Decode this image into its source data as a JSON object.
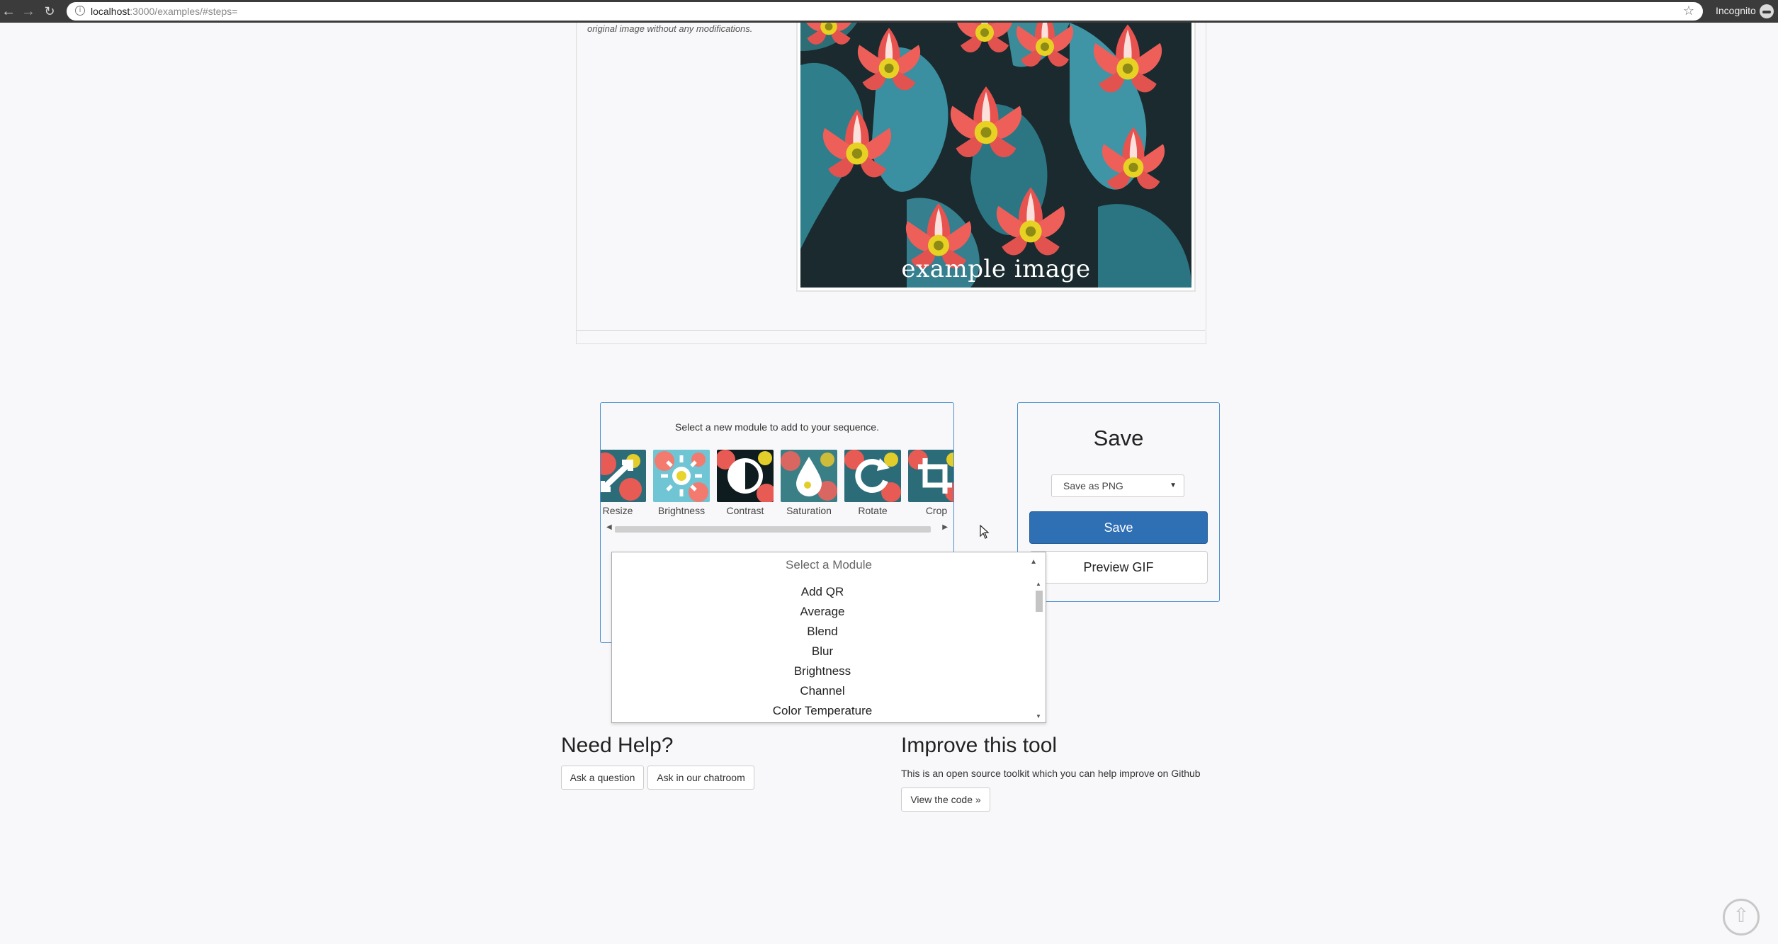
{
  "browser": {
    "url_host": "localhost",
    "url_rest": ":3000/examples/#steps=",
    "incognito_label": "Incognito",
    "icons": [
      "back-arrow-icon",
      "forward-arrow-icon",
      "reload-icon",
      "info-icon",
      "star-icon",
      "incognito-icon"
    ]
  },
  "top_card": {
    "caption": "original image without any modifications.",
    "image_label": "example image"
  },
  "module_selector": {
    "prompt": "Select a new module to add to your sequence.",
    "modules": [
      {
        "label": "Resize",
        "icon": "resize-icon"
      },
      {
        "label": "Brightness",
        "icon": "brightness-icon"
      },
      {
        "label": "Contrast",
        "icon": "contrast-icon"
      },
      {
        "label": "Saturation",
        "icon": "saturation-icon"
      },
      {
        "label": "Rotate",
        "icon": "rotate-icon"
      },
      {
        "label": "Crop",
        "icon": "crop-icon"
      }
    ]
  },
  "dropdown": {
    "header": "Select a Module",
    "options": [
      "Add QR",
      "Average",
      "Blend",
      "Blur",
      "Brightness",
      "Channel",
      "Color Temperature"
    ]
  },
  "save": {
    "title": "Save",
    "format_selected": "Save as PNG",
    "save_button": "Save",
    "preview_button": "Preview GIF"
  },
  "help": {
    "title": "Need Help?",
    "ask_question": "Ask a question",
    "chatroom": "Ask in our chatroom"
  },
  "improve": {
    "title": "Improve this tool",
    "description": "This is an open source toolkit which you can help improve on Github",
    "view_code": "View the code »"
  },
  "colors": {
    "accent": "#2f6fb4",
    "card_border": "#4a8fce",
    "page_bg": "#f8f8fa"
  }
}
